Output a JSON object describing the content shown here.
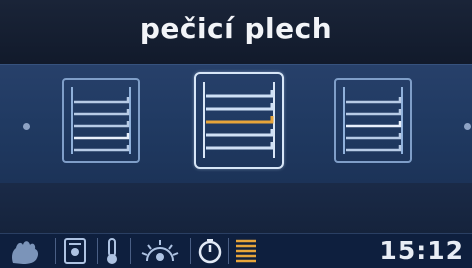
{
  "title": "pečicí plech",
  "tray_options": [
    {
      "position": "left",
      "levels": 5,
      "selected": false
    },
    {
      "position": "center",
      "levels": 5,
      "selected": true,
      "highlighted_level": 3
    },
    {
      "position": "right",
      "levels": 5,
      "selected": false
    }
  ],
  "status_bar": {
    "icons": [
      "hand-icon",
      "fan-icon",
      "thermometer-icon",
      "grill-heat-icon",
      "timer-icon",
      "tray-levels-icon"
    ],
    "clock": "15:12"
  },
  "colors": {
    "background": "#0a0f1c",
    "band": "#233e68",
    "frame": "#7f9ec8",
    "selected_frame": "#d7e6f7",
    "highlight": "#e7a53a",
    "status_bar": "#0e1f3e",
    "text": "#f2f4f8"
  }
}
